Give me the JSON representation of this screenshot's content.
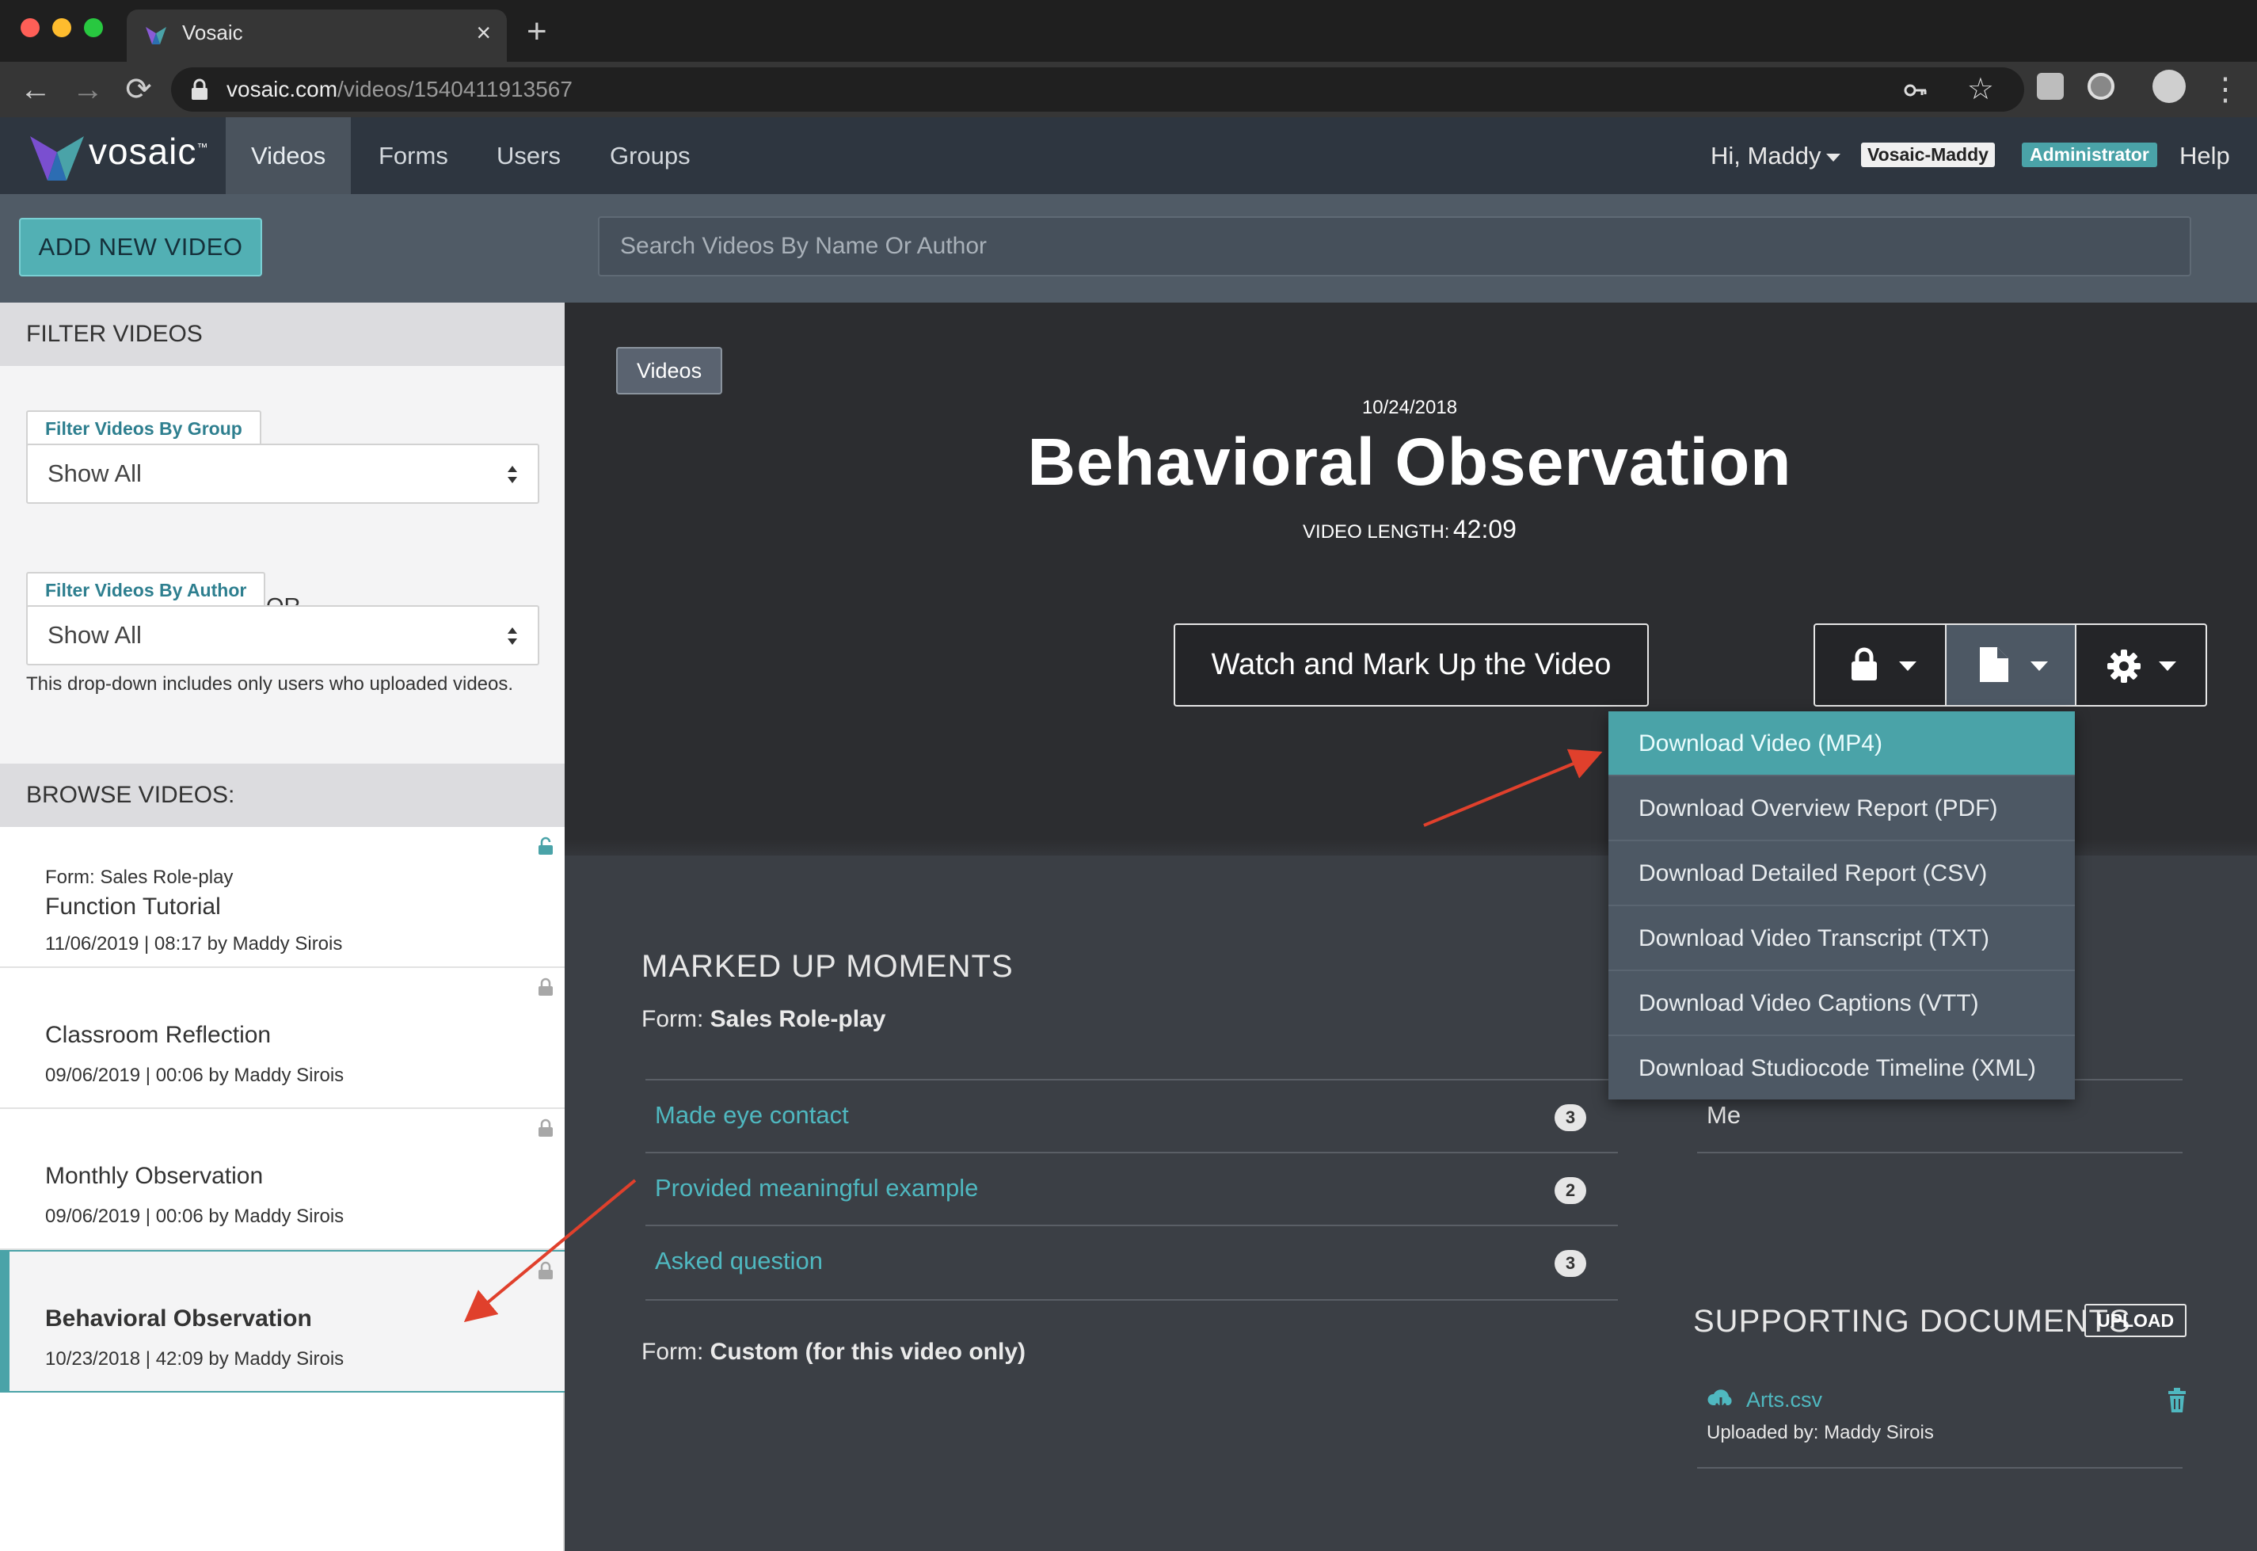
{
  "browser": {
    "tab_title": "Vosaic",
    "tab_close": "×",
    "new_tab": "+",
    "url_host": "vosaic.com",
    "url_path": "/videos/1540411913567",
    "back": "←",
    "forward": "→",
    "reload": "⟳",
    "star": "☆",
    "menu": "⋮"
  },
  "nav": {
    "logo_text": "vosaic",
    "logo_tm": "™",
    "links": [
      "Videos",
      "Forms",
      "Users",
      "Groups"
    ],
    "active": "Videos",
    "greeting": "Hi, Maddy",
    "account_badge": "Vosaic-Maddy",
    "role_badge": "Administrator",
    "help": "Help"
  },
  "toolbar": {
    "add_label": "ADD NEW VIDEO",
    "search_placeholder": "Search Videos By Name Or Author"
  },
  "sidebar": {
    "filter_heading": "FILTER VIDEOS",
    "group_label": "Filter Videos By Group",
    "group_value": "Show All",
    "or_text": "OR",
    "author_label": "Filter Videos By Author",
    "author_value": "Show All",
    "note": "This drop-down includes only users who uploaded videos.",
    "browse_heading": "BROWSE VIDEOS:",
    "videos": [
      {
        "form": "Form: Sales Role-play",
        "title": "Function Tutorial",
        "meta": "11/06/2019 | 08:17 by Maddy Sirois",
        "lock": "unlocked"
      },
      {
        "form": "",
        "title": "Classroom Reflection",
        "meta": "09/06/2019 | 00:06 by Maddy Sirois",
        "lock": "locked"
      },
      {
        "form": "",
        "title": "Monthly Observation",
        "meta": "09/06/2019 | 00:06 by Maddy Sirois",
        "lock": "locked"
      },
      {
        "form": "",
        "title": "Behavioral Observation",
        "meta": "10/23/2018 | 42:09 by Maddy Sirois",
        "lock": "locked",
        "selected": true
      }
    ]
  },
  "video": {
    "breadcrumb": "Videos",
    "date": "10/24/2018",
    "title": "Behavioral Observation",
    "length_label": "VIDEO LENGTH:",
    "length_value": "42:09",
    "watch_label": "Watch and Mark Up the Video"
  },
  "download_menu": {
    "items": [
      "Download Video (MP4)",
      "Download Overview Report (PDF)",
      "Download Detailed Report (CSV)",
      "Download Video Transcript (TXT)",
      "Download Video Captions (VTT)",
      "Download Studiocode Timeline (XML)"
    ],
    "active_index": 0
  },
  "moments": {
    "heading": "MARKED UP MOMENTS",
    "form_label": "Form:",
    "form_name": "Sales Role-play",
    "rows": [
      {
        "label": "Made eye contact",
        "count": "3"
      },
      {
        "label": "Provided meaningful example",
        "count": "2"
      },
      {
        "label": "Asked question",
        "count": "3"
      }
    ],
    "form2_label": "Form:",
    "form2_name": "Custom (for this video only)",
    "right_text": "Me"
  },
  "documents": {
    "heading": "SUPPORTING DOCUMENTS",
    "upload": "UPLOAD",
    "file_name": "Arts.csv",
    "uploaded_by": "Uploaded by: Maddy Sirois"
  },
  "colors": {
    "accent": "#4aa3a8",
    "link": "#4fb8c0",
    "annotation_arrow": "#e0402c"
  }
}
